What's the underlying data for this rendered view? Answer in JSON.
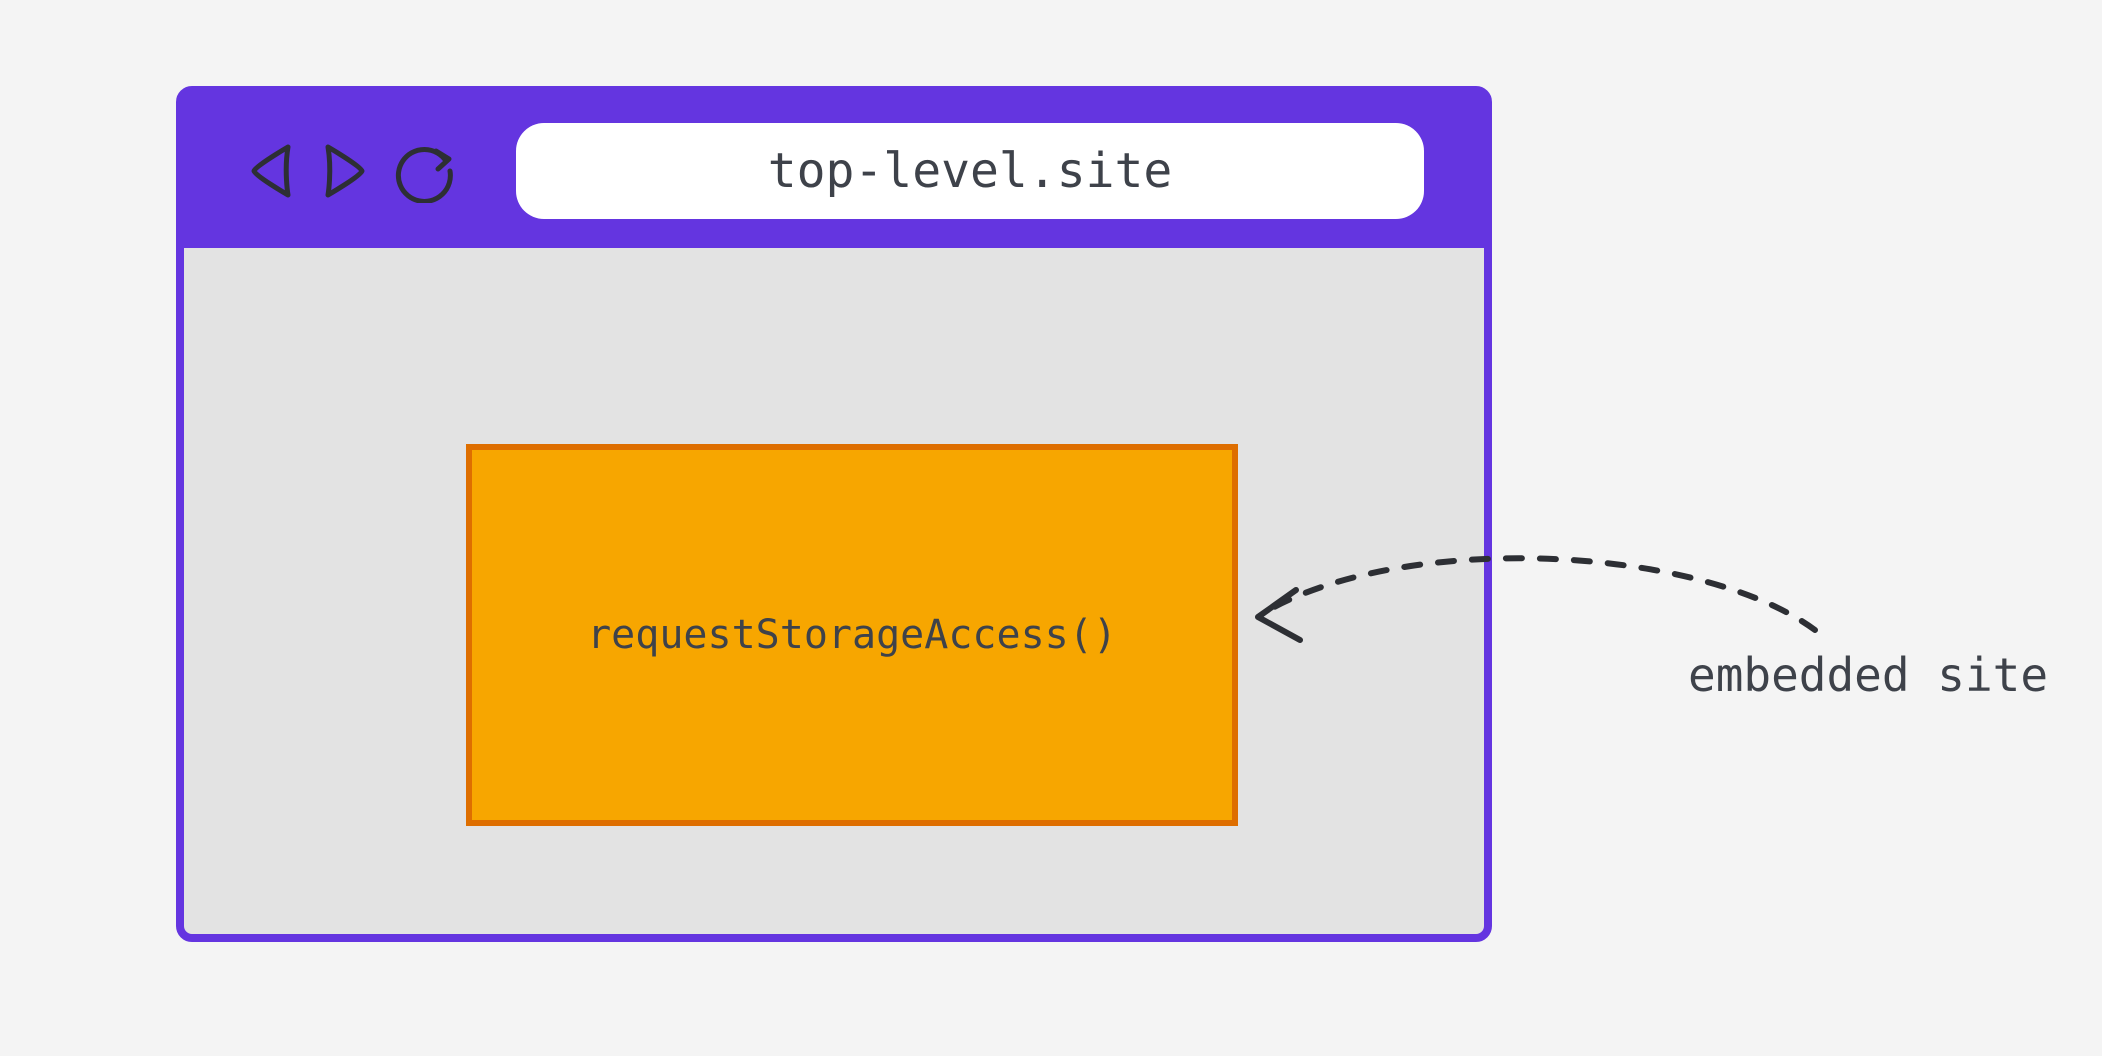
{
  "browser": {
    "url": "top-level.site"
  },
  "iframe": {
    "api_call": "requestStorageAccess()"
  },
  "annotation": {
    "label": "embedded site"
  },
  "colors": {
    "browser_chrome": "#6435e0",
    "frame_bg": "#f7a600",
    "frame_border": "#de6e00",
    "canvas": "#e3e3e3"
  }
}
